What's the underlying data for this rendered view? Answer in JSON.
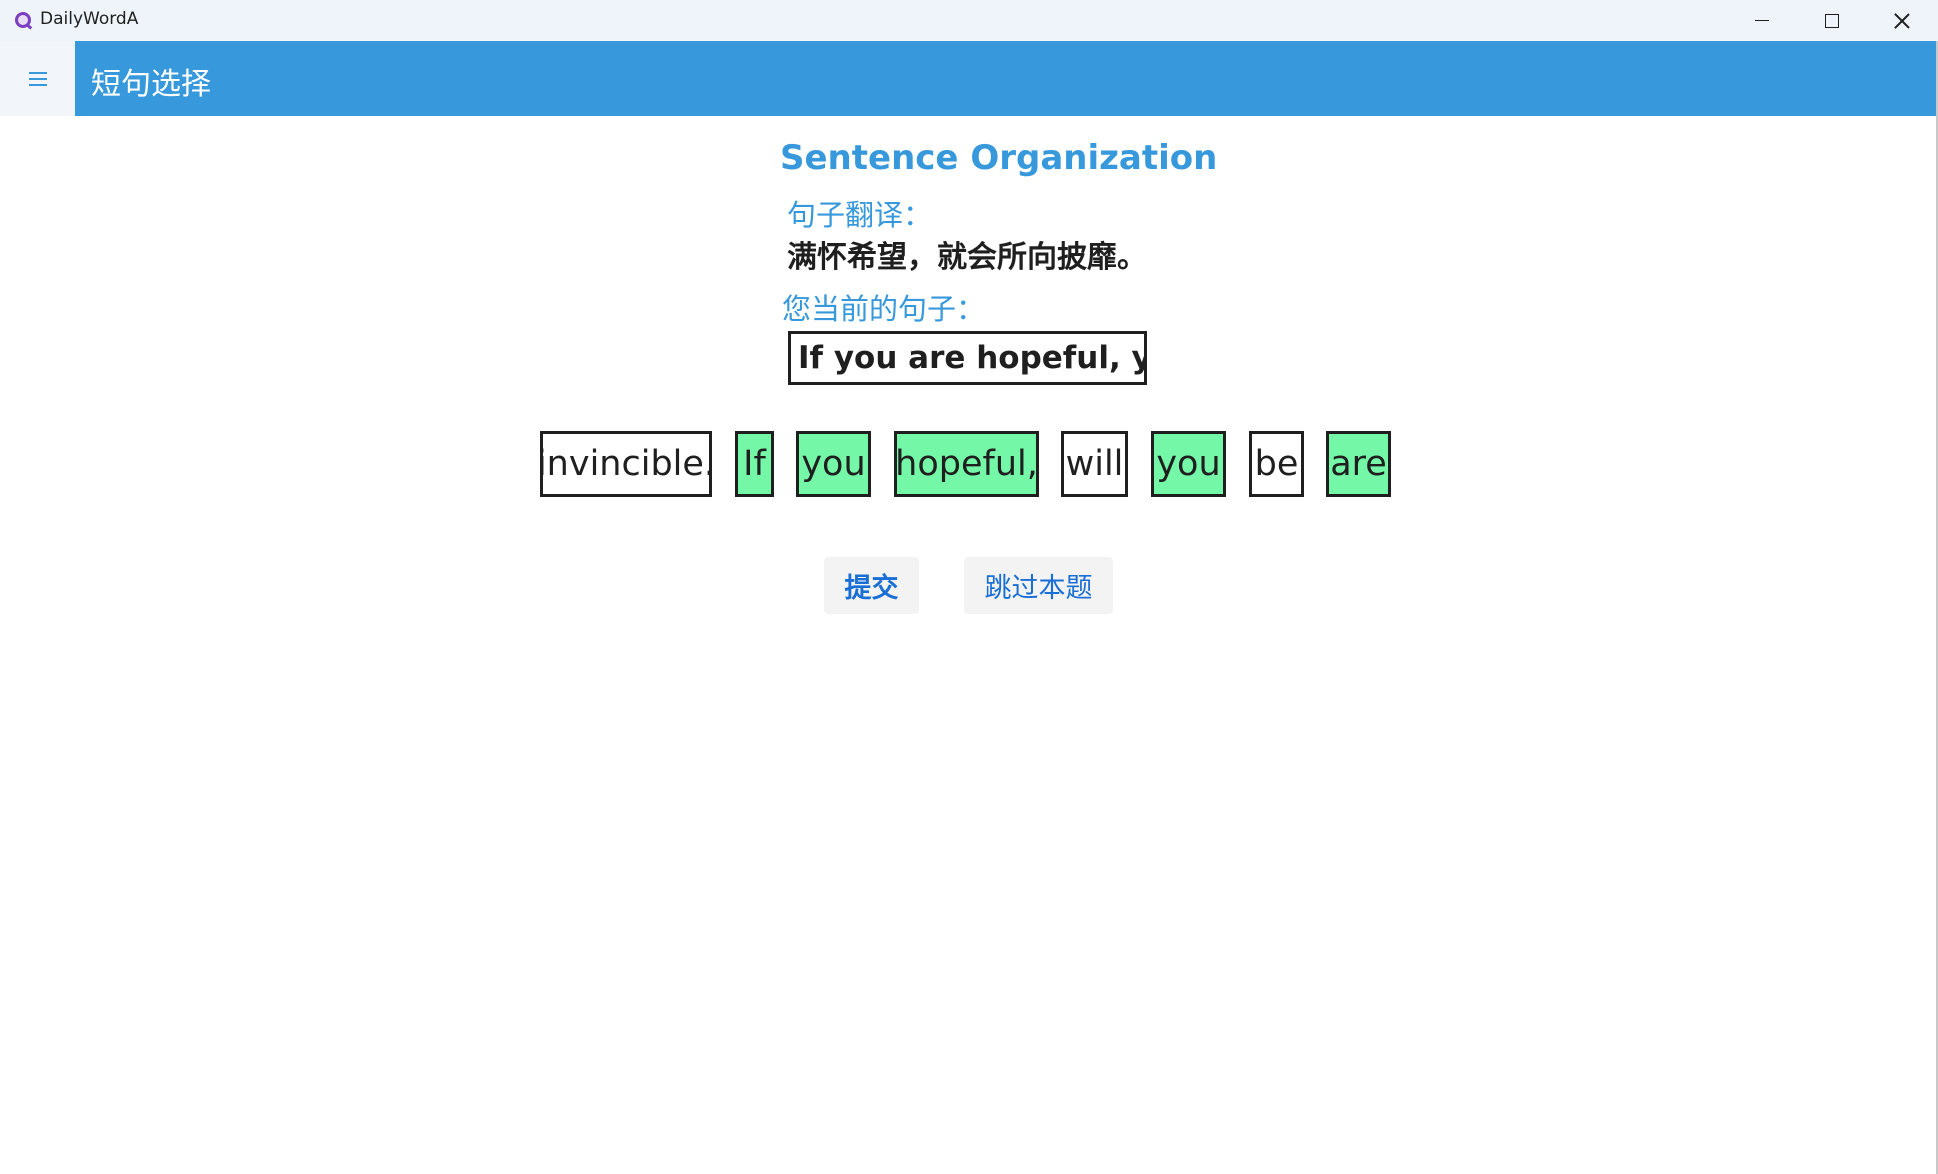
{
  "window": {
    "app_title": "DailyWordA"
  },
  "header": {
    "page_title": "短句选择"
  },
  "content": {
    "title": "Sentence Organization",
    "translation_label": "句子翻译：",
    "translation_text": "满怀希望，就会所向披靡。",
    "current_label": "您当前的句子：",
    "current_sentence": "If you are hopeful, you"
  },
  "word_chips": [
    {
      "text": "invincible.",
      "selected": false
    },
    {
      "text": "If",
      "selected": true
    },
    {
      "text": "you",
      "selected": true
    },
    {
      "text": "hopeful,",
      "selected": true
    },
    {
      "text": "will",
      "selected": false
    },
    {
      "text": "you",
      "selected": true
    },
    {
      "text": "be",
      "selected": false
    },
    {
      "text": "are",
      "selected": true
    }
  ],
  "actions": {
    "submit_label": "提交",
    "skip_label": "跳过本题"
  },
  "colors": {
    "accent": "#3799dc",
    "selected_chip": "#74f7a6",
    "button_text": "#1a6fd6"
  },
  "icons": {
    "menu": "hamburger-icon",
    "app": "app-logo-icon"
  }
}
